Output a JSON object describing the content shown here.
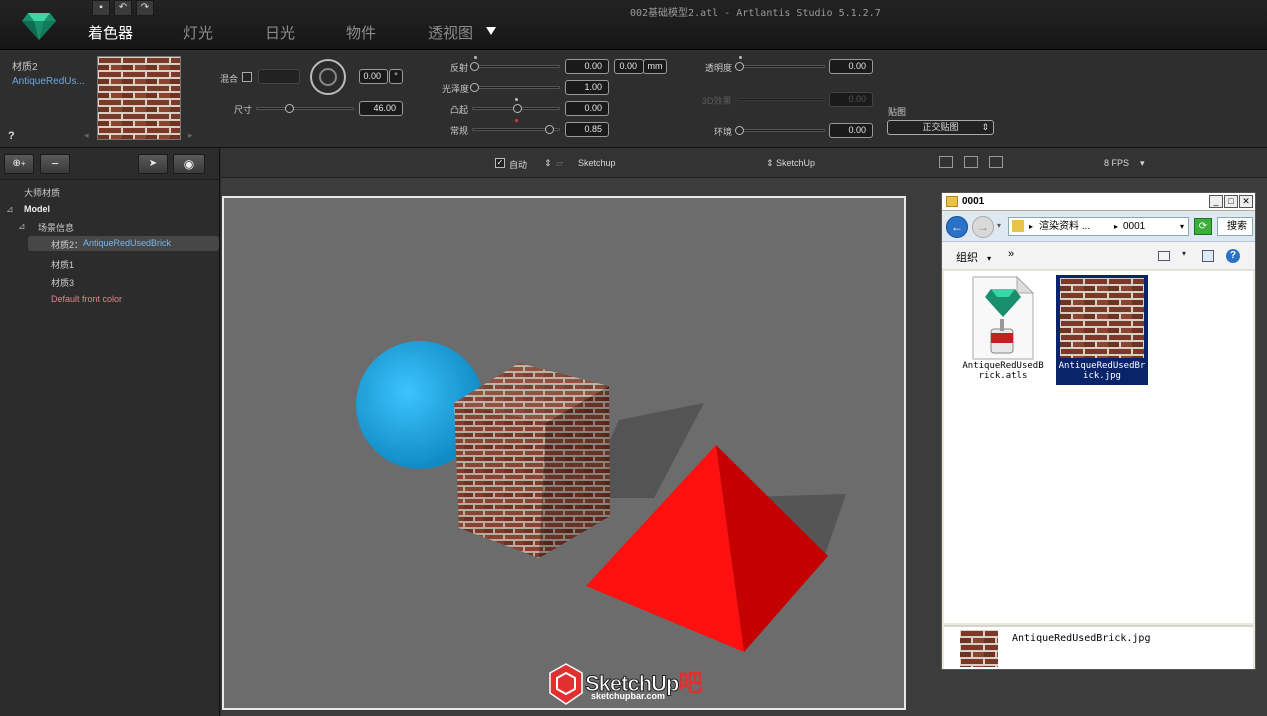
{
  "window": {
    "title": "002基础模型2.atl - Artlantis Studio 5.1.2.7"
  },
  "toolbar": {
    "save_icon": "save-icon",
    "undo_icon": "undo-icon",
    "redo_icon": "redo-icon"
  },
  "tabs": [
    {
      "label": "着色器",
      "active": true
    },
    {
      "label": "灯光",
      "active": false
    },
    {
      "label": "日光",
      "active": false
    },
    {
      "label": "物件",
      "active": false
    },
    {
      "label": "透视图",
      "active": false
    }
  ],
  "material": {
    "name": "材质2",
    "subname": "AntiqueRedUs...",
    "help": "?",
    "mix_label": "混合",
    "size_label": "尺寸",
    "size_value": "46.00",
    "angle_value": "0.00",
    "angle_unit": "°",
    "reflection_label": "反射",
    "reflection_value": "0.00",
    "reflection_mm": "0.00",
    "mm_unit": "mm",
    "gloss_label": "光泽度",
    "gloss_value": "1.00",
    "bump_label": "凸起",
    "bump_value": "0.00",
    "normal_label": "常规",
    "normal_value": "0.85",
    "transparency_label": "透明度",
    "transparency_value": "0.00",
    "effect3d_label": "3D效果",
    "effect3d_value": "0.00",
    "env_label": "环境",
    "env_value": "0.00",
    "mapping_label": "贴图",
    "mapping_value": "正交贴图"
  },
  "tree": {
    "items": [
      {
        "label": "大师材质"
      },
      {
        "label": "Model"
      },
      {
        "label": "场景信息"
      },
      {
        "label": "材质2：",
        "suffix": "AntiqueRedUsedBrick"
      },
      {
        "label": "材质1"
      },
      {
        "label": "材质3"
      },
      {
        "label": "Default front color"
      }
    ]
  },
  "viewbar": {
    "auto_label": "自动",
    "left_camera": "Sketchup",
    "right_camera": "SketchUp",
    "fps": "8 FPS"
  },
  "explorer": {
    "title": "0001",
    "path_part1": "渲染资料 ...",
    "path_part2": "0001",
    "search_label": "搜索",
    "organize": "组织",
    "more": "»",
    "files": [
      {
        "name": "AntiqueRedUsedBrick.atls"
      },
      {
        "name": "AntiqueRedUsedBrick.jpg"
      }
    ],
    "selected_file": "AntiqueRedUsedBrick.jpg"
  },
  "watermark": {
    "brand": "SketchUp",
    "suffix": "吧",
    "url": "sketchupbar.com"
  },
  "colors": {
    "sphere": "#1aa9e8",
    "pyramid": "#ff0f0f",
    "brick": "#7a3a28",
    "selection": "#0a246a"
  }
}
